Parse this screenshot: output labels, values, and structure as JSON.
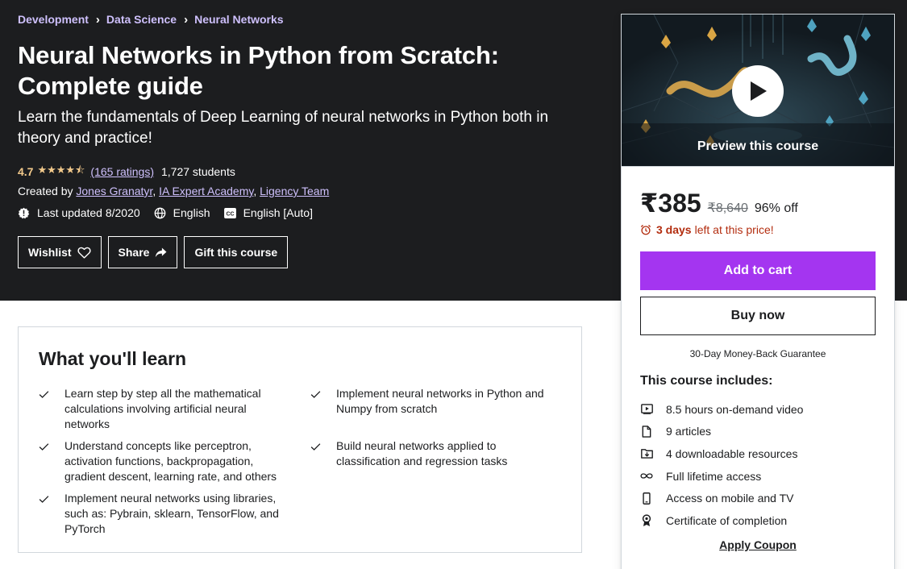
{
  "breadcrumbs": [
    "Development",
    "Data Science",
    "Neural Networks"
  ],
  "course": {
    "title": "Neural Networks in Python from Scratch: Complete guide",
    "headline": "Learn the fundamentals of Deep Learning of neural networks in Python both in theory and practice!",
    "rating": "4.7",
    "ratings_count": "(165 ratings)",
    "students": "1,727 students",
    "created_by_label": "Created by",
    "instructors": [
      "Jones Granatyr",
      "IA Expert Academy",
      "Ligency Team"
    ],
    "last_updated": "Last updated 8/2020",
    "language": "English",
    "captions": "English [Auto]"
  },
  "actions": {
    "wishlist": "Wishlist",
    "share": "Share",
    "gift": "Gift this course"
  },
  "sidebar": {
    "preview_label": "Preview this course",
    "price": "₹385",
    "original_price": "₹8,640",
    "discount": "96% off",
    "timer_bold": "3 days",
    "timer_rest": "left at this price!",
    "add_to_cart": "Add to cart",
    "buy_now": "Buy now",
    "guarantee": "30-Day Money-Back Guarantee",
    "includes_title": "This course includes:",
    "includes": [
      {
        "icon": "video-icon",
        "text": "8.5 hours on-demand video"
      },
      {
        "icon": "file-icon",
        "text": "9 articles"
      },
      {
        "icon": "download-icon",
        "text": "4 downloadable resources"
      },
      {
        "icon": "infinity-icon",
        "text": "Full lifetime access"
      },
      {
        "icon": "mobile-icon",
        "text": "Access on mobile and TV"
      },
      {
        "icon": "certificate-icon",
        "text": "Certificate of completion"
      }
    ],
    "apply_coupon": "Apply Coupon"
  },
  "learn": {
    "title": "What you'll learn",
    "col1": [
      "Learn step by step all the mathematical calculations involving artificial neural networks",
      "Understand concepts like perceptron, activation functions, backpropagation, gradient descent, learning rate, and others",
      "Implement neural networks using libraries, such as: Pybrain, sklearn, TensorFlow, and PyTorch"
    ],
    "col2": [
      "Implement neural networks in Python and Numpy from scratch",
      "Build neural networks applied to classification and regression tasks"
    ]
  },
  "colors": {
    "hero_bg": "#1c1d1f",
    "accent_purple": "#a435f0",
    "link_lavender": "#cec0fc",
    "star_gold": "#f3ca8c",
    "timer_red": "#b32d0f"
  }
}
